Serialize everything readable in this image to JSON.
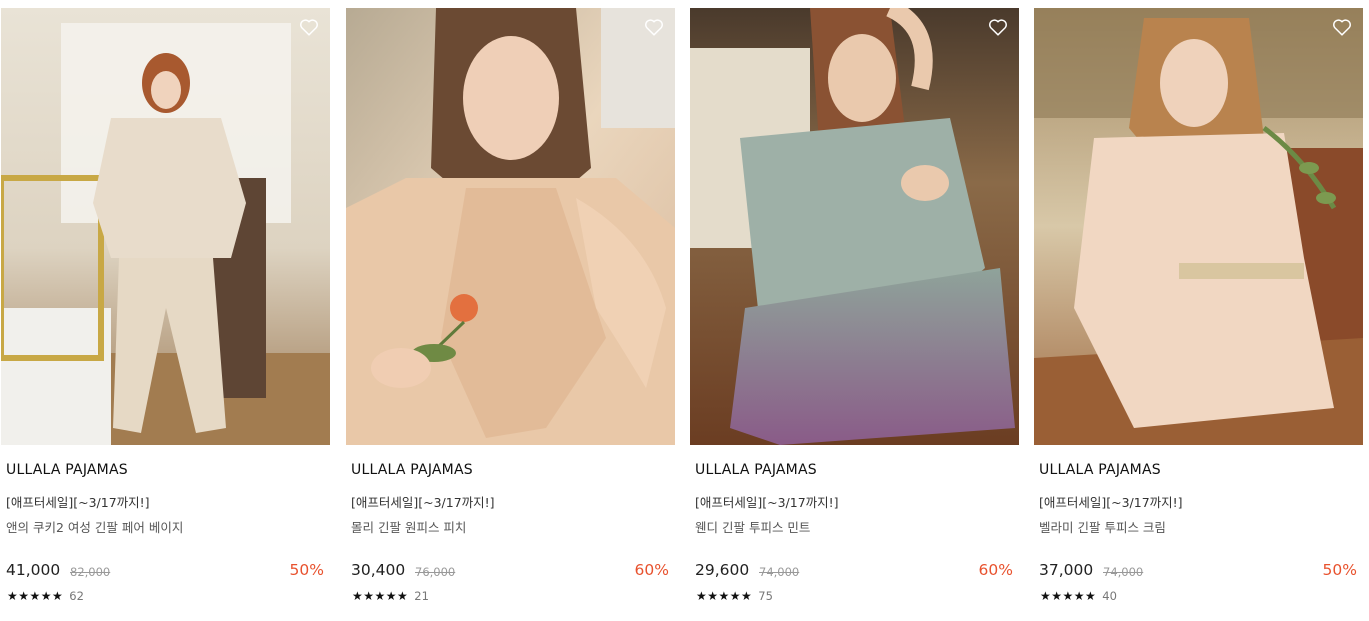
{
  "products": [
    {
      "image_alt": "앤의 쿠키2 여성 긴팔 페어 베이지",
      "brand": "ULLALA PAJAMAS",
      "event": "[애프터세일][~3/17까지!]",
      "name": "앤의 쿠키2 여성 긴팔 페어 베이지",
      "price": "41,000",
      "original_price": "82,000",
      "discount": "50%",
      "stars": "★★★★★",
      "rating": 5,
      "reviews": "62"
    },
    {
      "image_alt": "몰리 긴팔 원피스 피치",
      "brand": "ULLALA PAJAMAS",
      "event": "[애프터세일][~3/17까지!]",
      "name": "몰리 긴팔 원피스 피치",
      "price": "30,400",
      "original_price": "76,000",
      "discount": "60%",
      "stars": "★★★★★",
      "rating": 5,
      "reviews": "21"
    },
    {
      "image_alt": "웬디 긴팔 투피스 민트",
      "brand": "ULLALA PAJAMAS",
      "event": "[애프터세일][~3/17까지!]",
      "name": "웬디 긴팔 투피스 민트",
      "price": "29,600",
      "original_price": "74,000",
      "discount": "60%",
      "stars": "★★★★★",
      "rating": 5,
      "reviews": "75"
    },
    {
      "image_alt": "벨라미 긴팔 투피스 크림",
      "brand": "ULLALA PAJAMAS",
      "event": "[애프터세일][~3/17까지!]",
      "name": "벨라미 긴팔 투피스 크림",
      "price": "37,000",
      "original_price": "74,000",
      "discount": "50%",
      "stars": "★★★★★",
      "rating": 5,
      "reviews": "40"
    }
  ],
  "icons": {
    "wishlist": "heart-outline-icon",
    "rating": "star-icon"
  },
  "colors": {
    "discount": "#e8522e",
    "text": "#222222",
    "muted": "#999999"
  }
}
